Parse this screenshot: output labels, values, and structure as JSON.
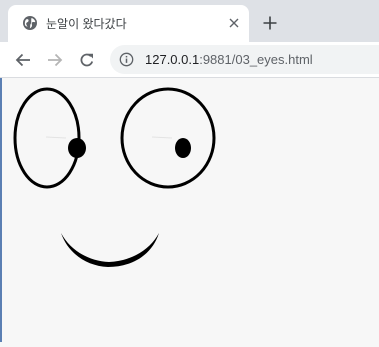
{
  "browser": {
    "tab": {
      "title": "눈알이 왔다갔다",
      "favicon": "globe-icon",
      "close_icon": "close-icon"
    },
    "new_tab_icon": "plus-icon",
    "toolbar": {
      "back_icon": "arrow-left-icon",
      "forward_icon": "arrow-right-icon",
      "reload_icon": "reload-icon",
      "security_icon": "info-icon"
    },
    "address": {
      "host": "127.0.0.1",
      "path": ":9881/03_eyes.html"
    }
  },
  "page": {
    "drawing": "face",
    "parts": [
      "left-eye",
      "right-eye",
      "mouth"
    ]
  },
  "colors": {
    "tabstrip": "#dee1e6",
    "page_background": "#f7f7f7",
    "stroke": "#000000",
    "forward_disabled": "#b5b5b5"
  }
}
